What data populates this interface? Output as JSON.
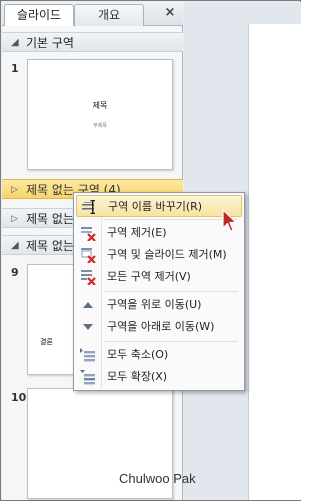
{
  "tabs": {
    "slides_label": "슬라이드",
    "outline_label": "개요",
    "close_glyph": "×"
  },
  "sections": [
    {
      "name": "기본 구역",
      "state": "expanded"
    },
    {
      "name": "제목 없는 구역 (4)",
      "state": "collapsed",
      "selected": true
    },
    {
      "name": "제목 없는 구역 (4)",
      "state": "collapsed"
    },
    {
      "name": "제목 없는 구역",
      "state": "expanded"
    }
  ],
  "slides": [
    {
      "number": "1",
      "title": "제목",
      "subtitle": "부제목"
    },
    {
      "number": "9",
      "title": "결론"
    },
    {
      "number": "10"
    }
  ],
  "context_menu": {
    "items": [
      {
        "label": "구역 이름 바꾸기(R)",
        "icon": "rename-section-icon",
        "hover": true
      },
      {
        "label": "구역 제거(E)",
        "icon": "remove-section-icon"
      },
      {
        "label": "구역 및 슬라이드 제거(M)",
        "icon": "remove-section-and-slides-icon"
      },
      {
        "label": "모든 구역 제거(V)",
        "icon": "remove-all-sections-icon"
      },
      {
        "label": "구역을 위로 이동(U)",
        "icon": "move-up-icon"
      },
      {
        "label": "구역을 아래로 이동(W)",
        "icon": "move-down-icon"
      },
      {
        "label": "모두 축소(O)",
        "icon": "collapse-all-icon"
      },
      {
        "label": "모두 확장(X)",
        "icon": "expand-all-icon"
      }
    ]
  },
  "footer": {
    "author": "Chulwoo Pak"
  },
  "colors": {
    "accent": "#f7d46a",
    "remove_red": "#d8262a",
    "panel_bg": "#f4f6f8"
  }
}
